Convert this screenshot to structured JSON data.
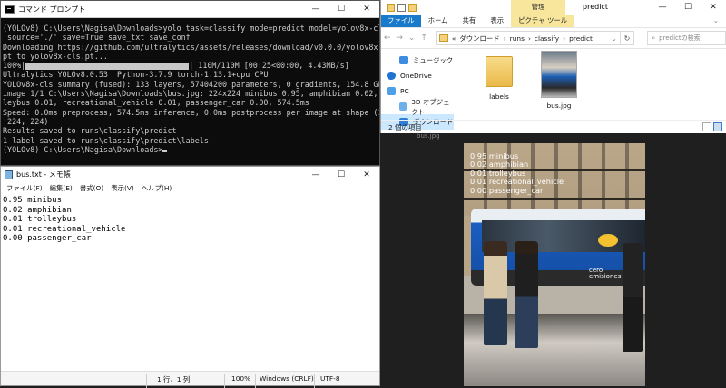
{
  "cmd": {
    "title": "コマンド プロンプト",
    "lines": [
      "(YOLOv8) C:\\Users\\Nagisa\\Downloads>yolo task=classify mode=predict model=yolov8x-cls.pt",
      " source='./' save=True save_txt save_conf",
      "Downloading https://github.com/ultralytics/assets/releases/download/v0.0.0/yolov8x-cls.",
      "pt to yolov8x-cls.pt..."
    ],
    "progress_prefix": "100%|",
    "progress_suffix": "| 110M/110M [00:25<00:00, 4.43MB/s]",
    "lines2": [
      "Ultralytics YOLOv8.0.53  Python-3.7.9 torch-1.13.1+cpu CPU",
      "YOLOv8x-cls summary (fused): 133 layers, 57404200 parameters, 0 gradients, 154.8 GFLOPs",
      "",
      "image 1/1 C:\\Users\\Nagisa\\Downloads\\bus.jpg: 224x224 minibus 0.95, amphibian 0.02, trol",
      "leybus 0.01, recreational_vehicle 0.01, passenger_car 0.00, 574.5ms",
      "Speed: 0.0ms preprocess, 574.5ms inference, 0.0ms postprocess per image at shape (1, 3,",
      " 224, 224)",
      "Results saved to runs\\classify\\predict",
      "1 label saved to runs\\classify\\predict\\labels",
      "",
      "(YOLOv8) C:\\Users\\Nagisa\\Downloads>"
    ]
  },
  "notepad": {
    "title": "bus.txt - メモ帳",
    "menu": [
      "ファイル(F)",
      "編集(E)",
      "書式(O)",
      "表示(V)",
      "ヘルプ(H)"
    ],
    "lines": [
      "0.95 minibus",
      "0.02 amphibian",
      "0.01 trolleybus",
      "0.01 recreational_vehicle",
      "0.00 passenger_car"
    ],
    "status": {
      "position": "1 行、1 列",
      "zoom": "100%",
      "eol": "Windows (CRLF)",
      "encoding": "UTF-8"
    }
  },
  "explorer": {
    "title": "predict",
    "manage_tab": "管理",
    "ribbon_tabs": [
      "ファイル",
      "ホーム",
      "共有",
      "表示",
      "ピクチャ ツール"
    ],
    "path": [
      "«",
      "ダウンロード",
      "›",
      "runs",
      "›",
      "classify",
      "›",
      "predict"
    ],
    "search_placeholder": "predictの検索",
    "nav": [
      "ミュージック",
      "OneDrive",
      "PC",
      "3D オブジェクト",
      "ダウンロード"
    ],
    "files": [
      "labels",
      "bus.jpg"
    ],
    "status": "2 個の項目"
  },
  "viewer": {
    "tab": "bus.jpg",
    "overlay_lines": [
      "0.95 minibus",
      "0.02 amphibian",
      "0.01 trolleybus",
      "0.01 recreational_vehicle",
      "0.00 passenger_car"
    ],
    "bus_text": "cero emisiones"
  }
}
